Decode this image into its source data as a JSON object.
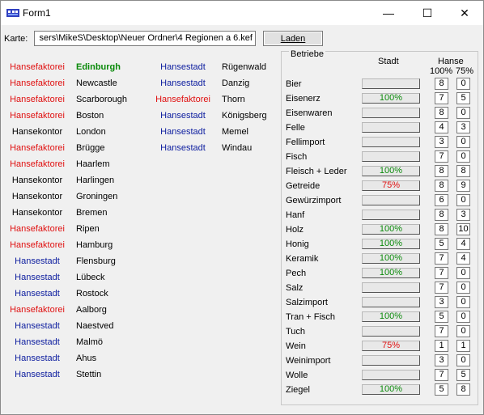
{
  "window": {
    "title": "Form1",
    "minimize": "—",
    "maximize": "☐",
    "close": "✕"
  },
  "karte": {
    "label": "Karte:",
    "path": "sers\\MikeS\\Desktop\\Neuer Ordner\\4 Regionen a 6.kef",
    "load_button": "Laden"
  },
  "cities_col1": [
    {
      "type": "Hansefaktorei",
      "type_color": "red",
      "city": "Edinburgh",
      "city_style": "green-bold"
    },
    {
      "type": "Hansefaktorei",
      "type_color": "red",
      "city": "Newcastle",
      "city_style": "black"
    },
    {
      "type": "Hansefaktorei",
      "type_color": "red",
      "city": "Scarborough",
      "city_style": "black"
    },
    {
      "type": "Hansefaktorei",
      "type_color": "red",
      "city": "Boston",
      "city_style": "black"
    },
    {
      "type": "Hansekontor",
      "type_color": "black",
      "city": "London",
      "city_style": "black"
    },
    {
      "type": "Hansefaktorei",
      "type_color": "red",
      "city": "Brügge",
      "city_style": "black"
    },
    {
      "type": "Hansefaktorei",
      "type_color": "red",
      "city": "Haarlem",
      "city_style": "black"
    },
    {
      "type": "Hansekontor",
      "type_color": "black",
      "city": "Harlingen",
      "city_style": "black"
    },
    {
      "type": "Hansekontor",
      "type_color": "black",
      "city": "Groningen",
      "city_style": "black"
    },
    {
      "type": "Hansekontor",
      "type_color": "black",
      "city": "Bremen",
      "city_style": "black"
    },
    {
      "type": "Hansefaktorei",
      "type_color": "red",
      "city": "Ripen",
      "city_style": "black"
    },
    {
      "type": "Hansefaktorei",
      "type_color": "red",
      "city": "Hamburg",
      "city_style": "black"
    },
    {
      "type": "Hansestadt",
      "type_color": "blue",
      "city": "Flensburg",
      "city_style": "black"
    },
    {
      "type": "Hansestadt",
      "type_color": "blue",
      "city": "Lübeck",
      "city_style": "black"
    },
    {
      "type": "Hansestadt",
      "type_color": "blue",
      "city": "Rostock",
      "city_style": "black"
    },
    {
      "type": "Hansefaktorei",
      "type_color": "red",
      "city": "Aalborg",
      "city_style": "black"
    },
    {
      "type": "Hansestadt",
      "type_color": "blue",
      "city": "Naestved",
      "city_style": "black"
    },
    {
      "type": "Hansestadt",
      "type_color": "blue",
      "city": "Malmö",
      "city_style": "black"
    },
    {
      "type": "Hansestadt",
      "type_color": "blue",
      "city": "Ahus",
      "city_style": "black"
    },
    {
      "type": "Hansestadt",
      "type_color": "blue",
      "city": "Stettin",
      "city_style": "black"
    }
  ],
  "cities_col2": [
    {
      "type": "Hansestadt",
      "type_color": "blue",
      "city": "Rügenwald",
      "city_style": "black"
    },
    {
      "type": "Hansestadt",
      "type_color": "blue",
      "city": "Danzig",
      "city_style": "black"
    },
    {
      "type": "Hansefaktorei",
      "type_color": "red",
      "city": "Thorn",
      "city_style": "black"
    },
    {
      "type": "Hansestadt",
      "type_color": "blue",
      "city": "Königsberg",
      "city_style": "black"
    },
    {
      "type": "Hansestadt",
      "type_color": "blue",
      "city": "Memel",
      "city_style": "black"
    },
    {
      "type": "Hansestadt",
      "type_color": "blue",
      "city": "Windau",
      "city_style": "black"
    }
  ],
  "betriebe": {
    "title": "Betriebe",
    "header_stadt": "Stadt",
    "header_hanse": "Hanse",
    "header_100": "100%",
    "header_75": "75%",
    "rows": [
      {
        "name": "Bier",
        "stadt": "",
        "stadt_color": "green",
        "h100": "8",
        "h75": "0"
      },
      {
        "name": "Eisenerz",
        "stadt": "100%",
        "stadt_color": "green",
        "h100": "7",
        "h75": "5"
      },
      {
        "name": "Eisenwaren",
        "stadt": "",
        "stadt_color": "green",
        "h100": "8",
        "h75": "0"
      },
      {
        "name": "Felle",
        "stadt": "",
        "stadt_color": "green",
        "h100": "4",
        "h75": "3"
      },
      {
        "name": "Fellimport",
        "stadt": "",
        "stadt_color": "green",
        "h100": "3",
        "h75": "0"
      },
      {
        "name": "Fisch",
        "stadt": "",
        "stadt_color": "green",
        "h100": "7",
        "h75": "0"
      },
      {
        "name": "Fleisch + Leder",
        "stadt": "100%",
        "stadt_color": "green",
        "h100": "8",
        "h75": "8"
      },
      {
        "name": "Getreide",
        "stadt": "75%",
        "stadt_color": "red",
        "h100": "8",
        "h75": "9"
      },
      {
        "name": "Gewürzimport",
        "stadt": "",
        "stadt_color": "green",
        "h100": "6",
        "h75": "0"
      },
      {
        "name": "Hanf",
        "stadt": "",
        "stadt_color": "green",
        "h100": "8",
        "h75": "3"
      },
      {
        "name": "Holz",
        "stadt": "100%",
        "stadt_color": "green",
        "h100": "8",
        "h75": "10"
      },
      {
        "name": "Honig",
        "stadt": "100%",
        "stadt_color": "green",
        "h100": "5",
        "h75": "4"
      },
      {
        "name": "Keramik",
        "stadt": "100%",
        "stadt_color": "green",
        "h100": "7",
        "h75": "4"
      },
      {
        "name": "Pech",
        "stadt": "100%",
        "stadt_color": "green",
        "h100": "7",
        "h75": "0"
      },
      {
        "name": "Salz",
        "stadt": "",
        "stadt_color": "green",
        "h100": "7",
        "h75": "0"
      },
      {
        "name": "Salzimport",
        "stadt": "",
        "stadt_color": "green",
        "h100": "3",
        "h75": "0"
      },
      {
        "name": "Tran + Fisch",
        "stadt": "100%",
        "stadt_color": "green",
        "h100": "5",
        "h75": "0"
      },
      {
        "name": "Tuch",
        "stadt": "",
        "stadt_color": "green",
        "h100": "7",
        "h75": "0"
      },
      {
        "name": "Wein",
        "stadt": "75%",
        "stadt_color": "red",
        "h100": "1",
        "h75": "1"
      },
      {
        "name": "Weinimport",
        "stadt": "",
        "stadt_color": "green",
        "h100": "3",
        "h75": "0"
      },
      {
        "name": "Wolle",
        "stadt": "",
        "stadt_color": "green",
        "h100": "7",
        "h75": "5"
      },
      {
        "name": "Ziegel",
        "stadt": "100%",
        "stadt_color": "green",
        "h100": "5",
        "h75": "8"
      }
    ]
  }
}
